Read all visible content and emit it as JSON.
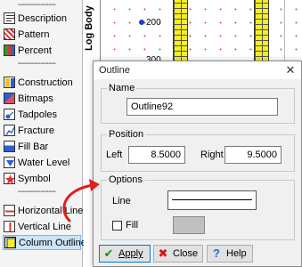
{
  "palette": {
    "separator": "---------------",
    "items": [
      {
        "label": "Description",
        "icon": "description-icon"
      },
      {
        "label": "Pattern",
        "icon": "pattern-icon"
      },
      {
        "label": "Percent",
        "icon": "percent-icon"
      },
      {
        "label": "Construction",
        "icon": "construction-icon"
      },
      {
        "label": "Bitmaps",
        "icon": "bitmaps-icon"
      },
      {
        "label": "Tadpoles",
        "icon": "tadpoles-icon"
      },
      {
        "label": "Fracture",
        "icon": "fracture-icon"
      },
      {
        "label": "Fill Bar",
        "icon": "fill-bar-icon"
      },
      {
        "label": "Water Level",
        "icon": "water-level-icon"
      },
      {
        "label": "Symbol",
        "icon": "symbol-icon"
      },
      {
        "label": "Horizontal Line",
        "icon": "horizontal-line-icon"
      },
      {
        "label": "Vertical Line",
        "icon": "vertical-line-icon"
      },
      {
        "label": "Column Outline",
        "icon": "column-outline-icon",
        "selected": true
      }
    ]
  },
  "log": {
    "title": "Log Body",
    "depth_200": "200",
    "depth_300": "300"
  },
  "dialog": {
    "title": "Outline",
    "close_glyph": "✕",
    "name_group": {
      "title": "Name",
      "value": "Outline92"
    },
    "position_group": {
      "title": "Position",
      "left_label": "Left",
      "left_value": "8.5000",
      "right_label": "Right",
      "right_value": "9.5000"
    },
    "options_group": {
      "title": "Options",
      "line_label": "Line",
      "fill_label": "Fill",
      "fill_checked": false
    },
    "buttons": {
      "apply": "Apply",
      "close": "Close",
      "help": "Help"
    }
  },
  "colors": {
    "accent": "#0078d7",
    "annotation_arrow": "#e0201b",
    "brick_fill": "#f5ef1f",
    "marker": "#1c3cd6",
    "fill_swatch": "#c0c0c0"
  }
}
